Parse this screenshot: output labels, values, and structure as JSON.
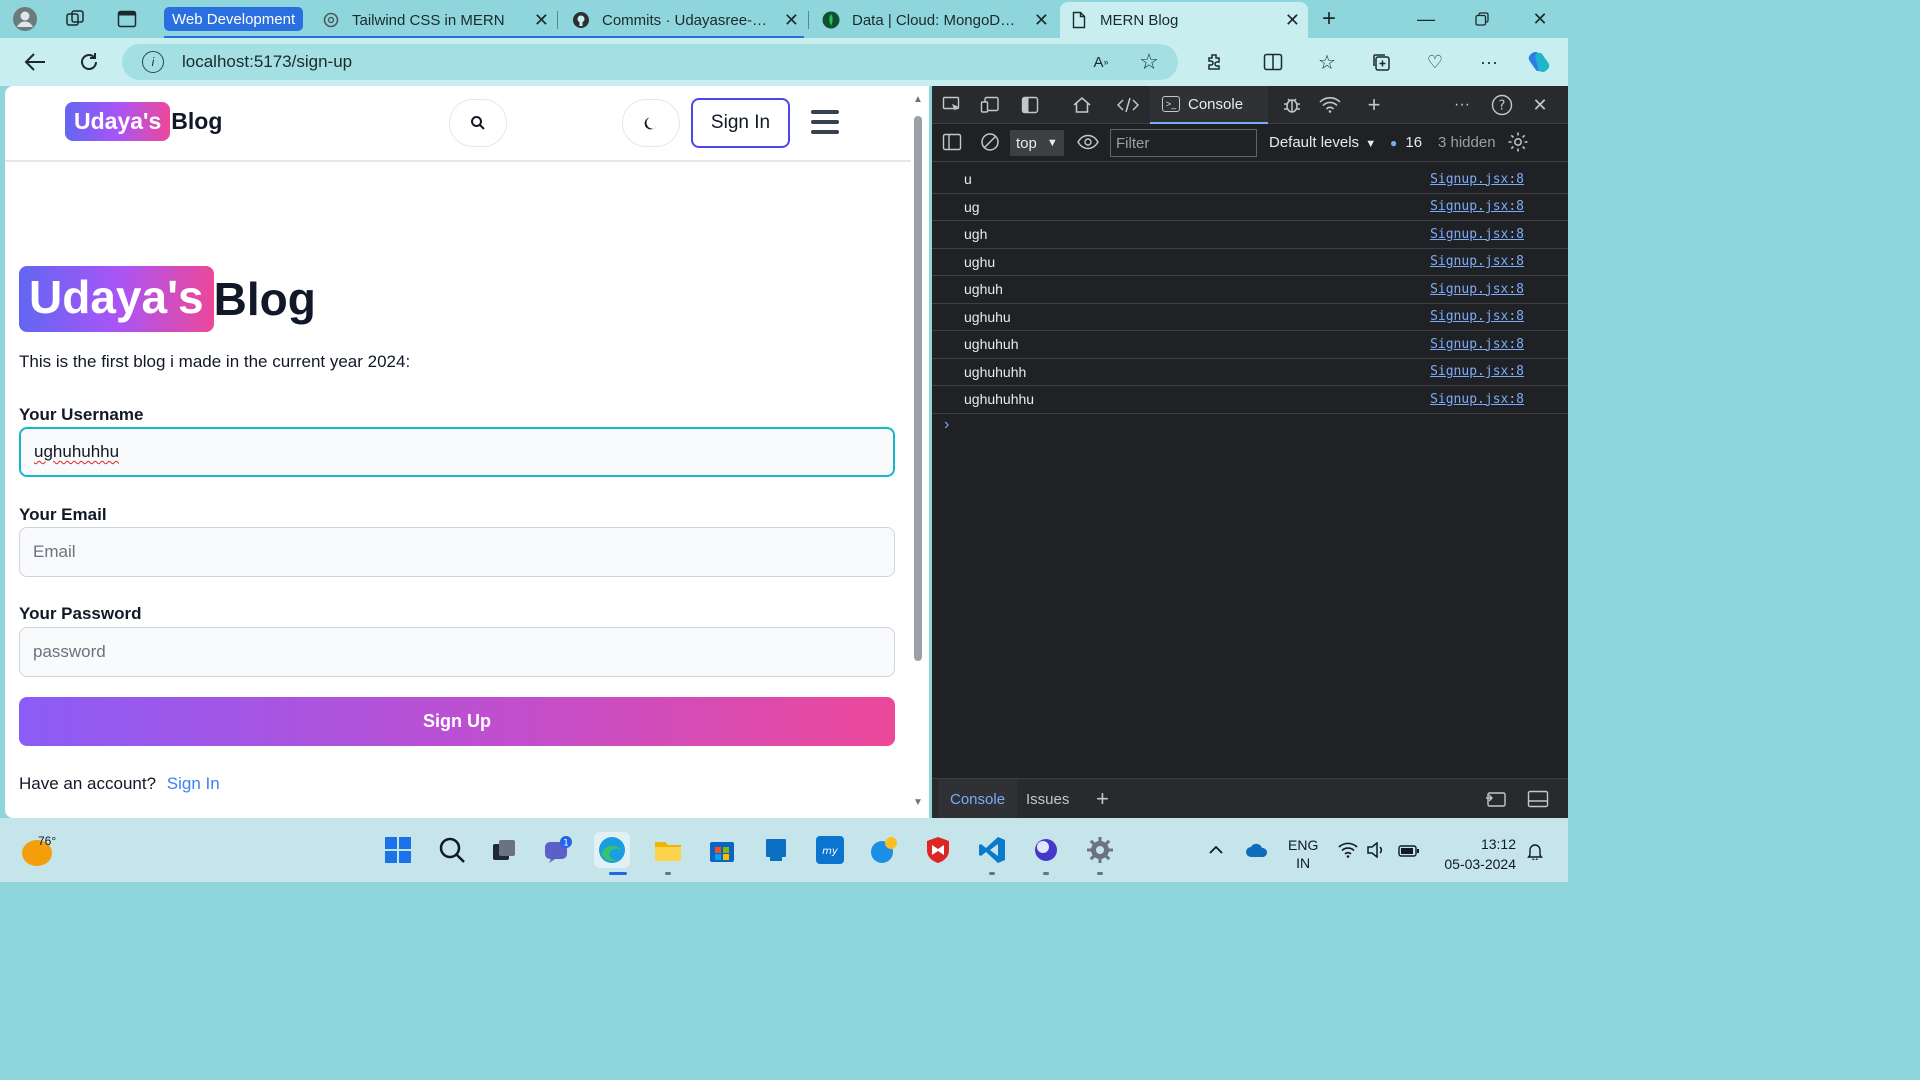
{
  "browser": {
    "tab_group": "Web Development",
    "tabs": [
      {
        "title": "Tailwind CSS in MERN",
        "favicon": "openai-icon"
      },
      {
        "title": "Commits · Udayasree-Banoth",
        "favicon": "github-icon"
      },
      {
        "title": "Data | Cloud: MongoDB Cloud",
        "favicon": "mongodb-icon"
      },
      {
        "title": "MERN Blog",
        "favicon": "document-icon"
      }
    ],
    "new_tab": "+",
    "url": "localhost:5173/sign-up"
  },
  "header": {
    "logo_highlight": "Udaya's",
    "logo_text": "Blog",
    "signin_label": "Sign In"
  },
  "hero": {
    "logo_highlight": "Udaya's",
    "logo_text": "Blog",
    "tagline": "This is the first blog i made in the current year 2024:"
  },
  "form": {
    "username_label": "Your Username",
    "username_value": "ughuhuhhu",
    "email_label": "Your Email",
    "email_placeholder": "Email",
    "password_label": "Your Password",
    "password_placeholder": "password",
    "submit_label": "Sign Up",
    "account_prompt": "Have an account?",
    "account_link": "Sign In"
  },
  "devtools": {
    "active_tab": "Console",
    "context": "top",
    "filter_placeholder": "Filter",
    "levels": "Default levels",
    "message_count": "16",
    "hidden": "3 hidden",
    "logs": [
      {
        "text": "u",
        "source": "Signup.jsx:8"
      },
      {
        "text": "ug",
        "source": "Signup.jsx:8"
      },
      {
        "text": "ugh",
        "source": "Signup.jsx:8"
      },
      {
        "text": "ughu",
        "source": "Signup.jsx:8"
      },
      {
        "text": "ughuh",
        "source": "Signup.jsx:8"
      },
      {
        "text": "ughuhu",
        "source": "Signup.jsx:8"
      },
      {
        "text": "ughuhuh",
        "source": "Signup.jsx:8"
      },
      {
        "text": "ughuhuhh",
        "source": "Signup.jsx:8"
      },
      {
        "text": "ughuhuhhu",
        "source": "Signup.jsx:8"
      }
    ],
    "drawer_tabs": [
      "Console",
      "Issues"
    ]
  },
  "taskbar": {
    "temperature": "76°",
    "chat_badge": "1",
    "language": "ENG",
    "region": "IN",
    "time": "13:12",
    "date": "05-03-2024"
  },
  "colors": {
    "accent": "#14b8c6",
    "gradient_start": "#8b5cf6",
    "gradient_end": "#ec4899",
    "link": "#3b82f6"
  }
}
